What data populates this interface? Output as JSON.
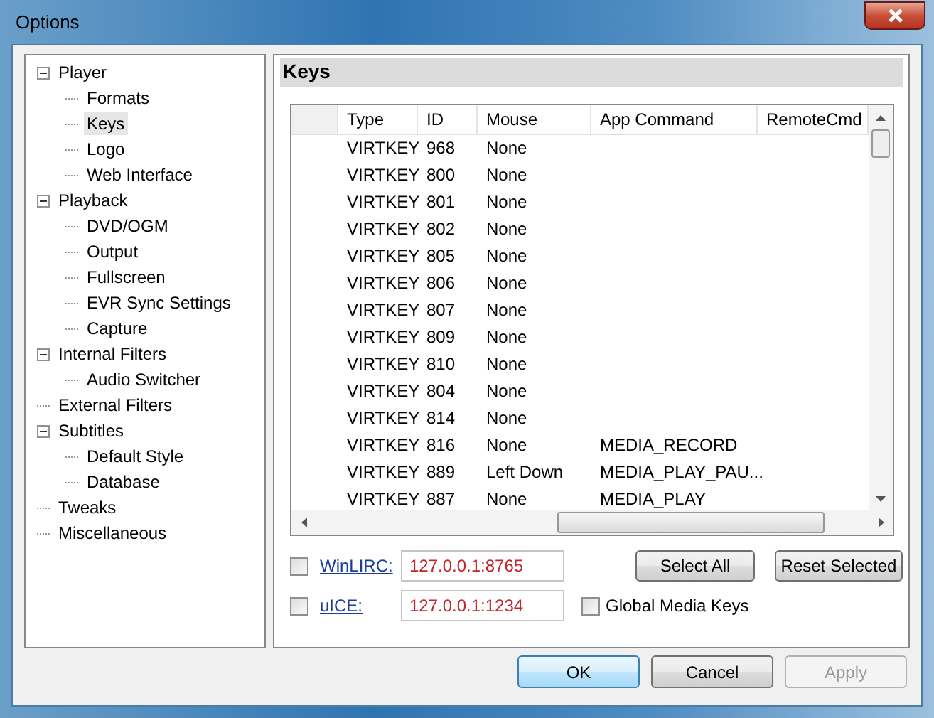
{
  "window": {
    "title": "Options"
  },
  "tree": [
    {
      "label": "Player",
      "expanded": true,
      "selected": false,
      "children": [
        {
          "label": "Formats",
          "selected": false
        },
        {
          "label": "Keys",
          "selected": true
        },
        {
          "label": "Logo",
          "selected": false
        },
        {
          "label": "Web Interface",
          "selected": false
        }
      ]
    },
    {
      "label": "Playback",
      "expanded": true,
      "selected": false,
      "children": [
        {
          "label": "DVD/OGM",
          "selected": false
        },
        {
          "label": "Output",
          "selected": false
        },
        {
          "label": "Fullscreen",
          "selected": false
        },
        {
          "label": "EVR Sync Settings",
          "selected": false
        },
        {
          "label": "Capture",
          "selected": false
        }
      ]
    },
    {
      "label": "Internal Filters",
      "expanded": true,
      "selected": false,
      "children": [
        {
          "label": "Audio Switcher",
          "selected": false
        }
      ]
    },
    {
      "label": "External Filters",
      "selected": false
    },
    {
      "label": "Subtitles",
      "expanded": true,
      "selected": false,
      "children": [
        {
          "label": "Default Style",
          "selected": false
        },
        {
          "label": "Database",
          "selected": false
        }
      ]
    },
    {
      "label": "Tweaks",
      "selected": false
    },
    {
      "label": "Miscellaneous",
      "selected": false
    }
  ],
  "page": {
    "title": "Keys"
  },
  "table": {
    "columns": [
      "Type",
      "ID",
      "Mouse",
      "App Command",
      "RemoteCmd"
    ],
    "rows": [
      {
        "type": "VIRTKEY",
        "id": "968",
        "mouse": "None"
      },
      {
        "type": "VIRTKEY",
        "id": "800",
        "mouse": "None"
      },
      {
        "type": "VIRTKEY",
        "id": "801",
        "mouse": "None"
      },
      {
        "type": "VIRTKEY",
        "id": "802",
        "mouse": "None"
      },
      {
        "type": "VIRTKEY",
        "id": "805",
        "mouse": "None"
      },
      {
        "type": "VIRTKEY",
        "id": "806",
        "mouse": "None"
      },
      {
        "type": "VIRTKEY",
        "id": "807",
        "mouse": "None"
      },
      {
        "type": "VIRTKEY",
        "id": "809",
        "mouse": "None"
      },
      {
        "type": "VIRTKEY",
        "id": "810",
        "mouse": "None"
      },
      {
        "type": "VIRTKEY",
        "id": "804",
        "mouse": "None"
      },
      {
        "type": "VIRTKEY",
        "id": "814",
        "mouse": "None"
      },
      {
        "type": "VIRTKEY",
        "id": "816",
        "mouse": "None",
        "app_command": "MEDIA_RECORD"
      },
      {
        "type": "VIRTKEY",
        "id": "889",
        "mouse": "Left Down",
        "app_command": "MEDIA_PLAY_PAU..."
      },
      {
        "type": "VIRTKEY",
        "id": "887",
        "mouse": "None",
        "app_command": "MEDIA_PLAY"
      }
    ]
  },
  "remotes": [
    {
      "label": "WinLIRC:",
      "checked": false,
      "value": "127.0.0.1:8765"
    },
    {
      "label": "uICE:",
      "checked": false,
      "value": "127.0.0.1:1234"
    }
  ],
  "global_media_keys": {
    "label": "Global Media Keys",
    "checked": false
  },
  "select_all": "Select All",
  "reset_selected": "Reset Selected",
  "dialog_buttons": [
    {
      "label": "OK",
      "default": true,
      "disabled": false
    },
    {
      "label": "Cancel",
      "default": false,
      "disabled": false
    },
    {
      "label": "Apply",
      "default": false,
      "disabled": true
    }
  ]
}
